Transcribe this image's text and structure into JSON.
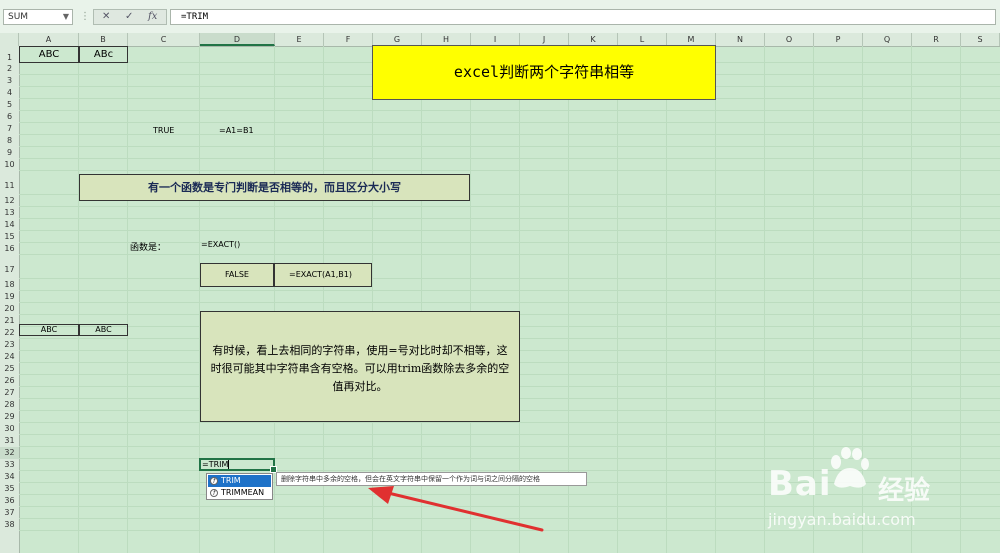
{
  "formula_bar": {
    "name_box": "SUM",
    "cancel_icon": "✕",
    "enter_icon": "✓",
    "fx_label": "fx",
    "formula": "=TRIM"
  },
  "columns": [
    "A",
    "B",
    "C",
    "D",
    "E",
    "F",
    "G",
    "H",
    "I",
    "J",
    "K",
    "L",
    "M",
    "N",
    "O",
    "P",
    "Q",
    "R",
    "S"
  ],
  "rows": [
    "1",
    "2",
    "3",
    "4",
    "5",
    "6",
    "7",
    "8",
    "9",
    "10",
    "11",
    "12",
    "13",
    "14",
    "15",
    "16",
    "17",
    "18",
    "19",
    "20",
    "21",
    "22",
    "23",
    "24",
    "25",
    "26",
    "27",
    "28",
    "29",
    "30",
    "31",
    "32",
    "33",
    "34",
    "35",
    "36",
    "37",
    "38"
  ],
  "cells": {
    "a1": "ABC",
    "b1": "ABc",
    "title": "excel判断两个字符串相等",
    "c7": "TRUE",
    "d7": "=A1=B1",
    "banner": "有一个函数是专门判断是否相等的，而且区分大小写",
    "c15": "函数是：",
    "d15": "=EXACT()",
    "d17": "FALSE",
    "e17": "=EXACT(A1,B1)",
    "a21": "ABC",
    "b21": "ABC",
    "note": "有时候，看上去相同的字符串，使用=号对比时却不相等，这时很可能其中字符串含有空格。可以用trim函数除去多余的空值再对比。",
    "d32": "=TRIM"
  },
  "autocomplete": {
    "items": [
      "TRIM",
      "TRIMMEAN"
    ],
    "tooltip": "删除字符串中多余的空格，但会在英文字符串中保留一个作为词与词之间分隔的空格"
  },
  "watermark": {
    "brand": "Bai",
    "brand_cn": "经验",
    "url": "jingyan.baidu.com"
  },
  "colors": {
    "grid_bg": "#cce8cf",
    "title_bg": "#ffff00",
    "box_bg": "#d8e4bc",
    "arrow": "#e03030",
    "selection": "#217346"
  }
}
